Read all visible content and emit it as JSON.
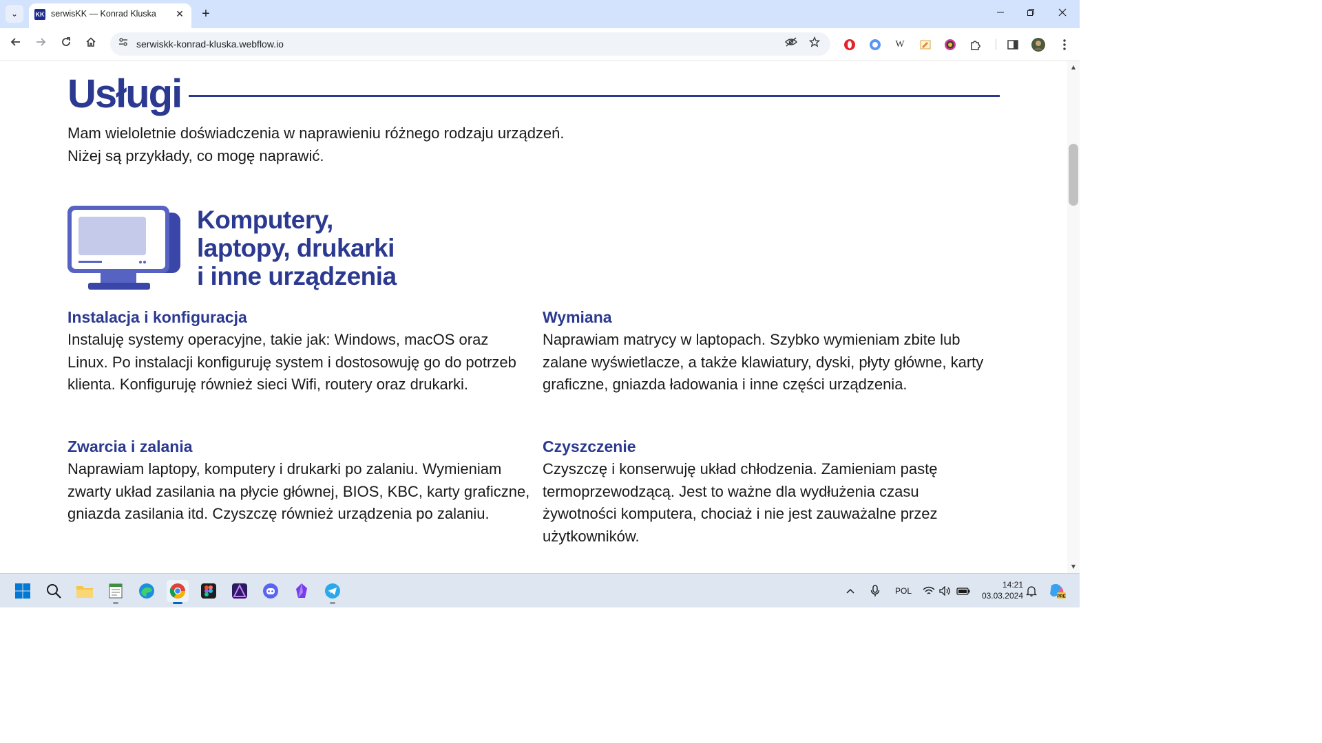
{
  "browser": {
    "tab_title": "serwisKK — Konrad Kluska",
    "favicon_text": "KK",
    "url": "serwiskk-konrad-kluska.webflow.io",
    "new_tab_symbol": "+",
    "close_tab_symbol": "✕",
    "extensions": [
      "opera-icon",
      "circle-extension-icon",
      "wikipedia-icon",
      "notes-extension-icon",
      "color-picker-icon",
      "puzzle-extensions-icon"
    ],
    "wiki_letter": "W"
  },
  "page": {
    "section_title": "Usługi",
    "intro_lines": [
      "Mam wieloletnie doświadczenia w naprawieniu różnego rodzaju urządzeń.",
      "Niżej są przykłady, co mogę naprawić."
    ],
    "category_title_lines": [
      "Komputery,",
      "laptopy, drukarki",
      "i inne urządzenia"
    ],
    "services": [
      {
        "title": "Instalacja i konfiguracja",
        "text": "Instaluję systemy operacyjne, takie jak: Windows, macOS oraz Linux. Po instalacji konfiguruję system i dostosowuję go do potrzeb klienta. Konfiguruję również sieci Wifi, routery oraz drukarki."
      },
      {
        "title": "Wymiana",
        "text": "Naprawiam matrycy w laptopach. Szybko wymieniam zbite lub zalane wyświetlacze, a także klawiatury, dyski, płyty główne, karty graficzne, gniazda ładowania i inne części urządzenia."
      },
      {
        "title": "Zwarcia i zalania",
        "text": "Naprawiam laptopy, komputery i drukarki po zalaniu. Wymieniam zwarty układ zasilania na płycie głównej, BIOS, KBC, karty graficzne, gniazda zasilania itd. Czyszczę również urządzenia po zalaniu."
      },
      {
        "title": "Czyszczenie",
        "text": "Czyszczę i konserwuję układ chłodzenia. Zamieniam pastę termoprzewodzącą. Jest to ważne dla wydłużenia czasu żywotności komputera, chociaż i nie jest zauważalne przez użytkowników."
      }
    ]
  },
  "taskbar": {
    "apps": [
      "start-icon",
      "search-icon",
      "file-explorer-icon",
      "notepad-icon",
      "edge-icon",
      "chrome-icon",
      "figma-icon",
      "affinity-designer-icon",
      "discord-icon",
      "obsidian-icon",
      "telegram-icon"
    ],
    "language": "POL",
    "time": "14:21",
    "date": "03.03.2024"
  },
  "colors": {
    "brand": "#2b3990",
    "tabbar": "#d3e3fd",
    "taskbar": "#dde6f1"
  }
}
